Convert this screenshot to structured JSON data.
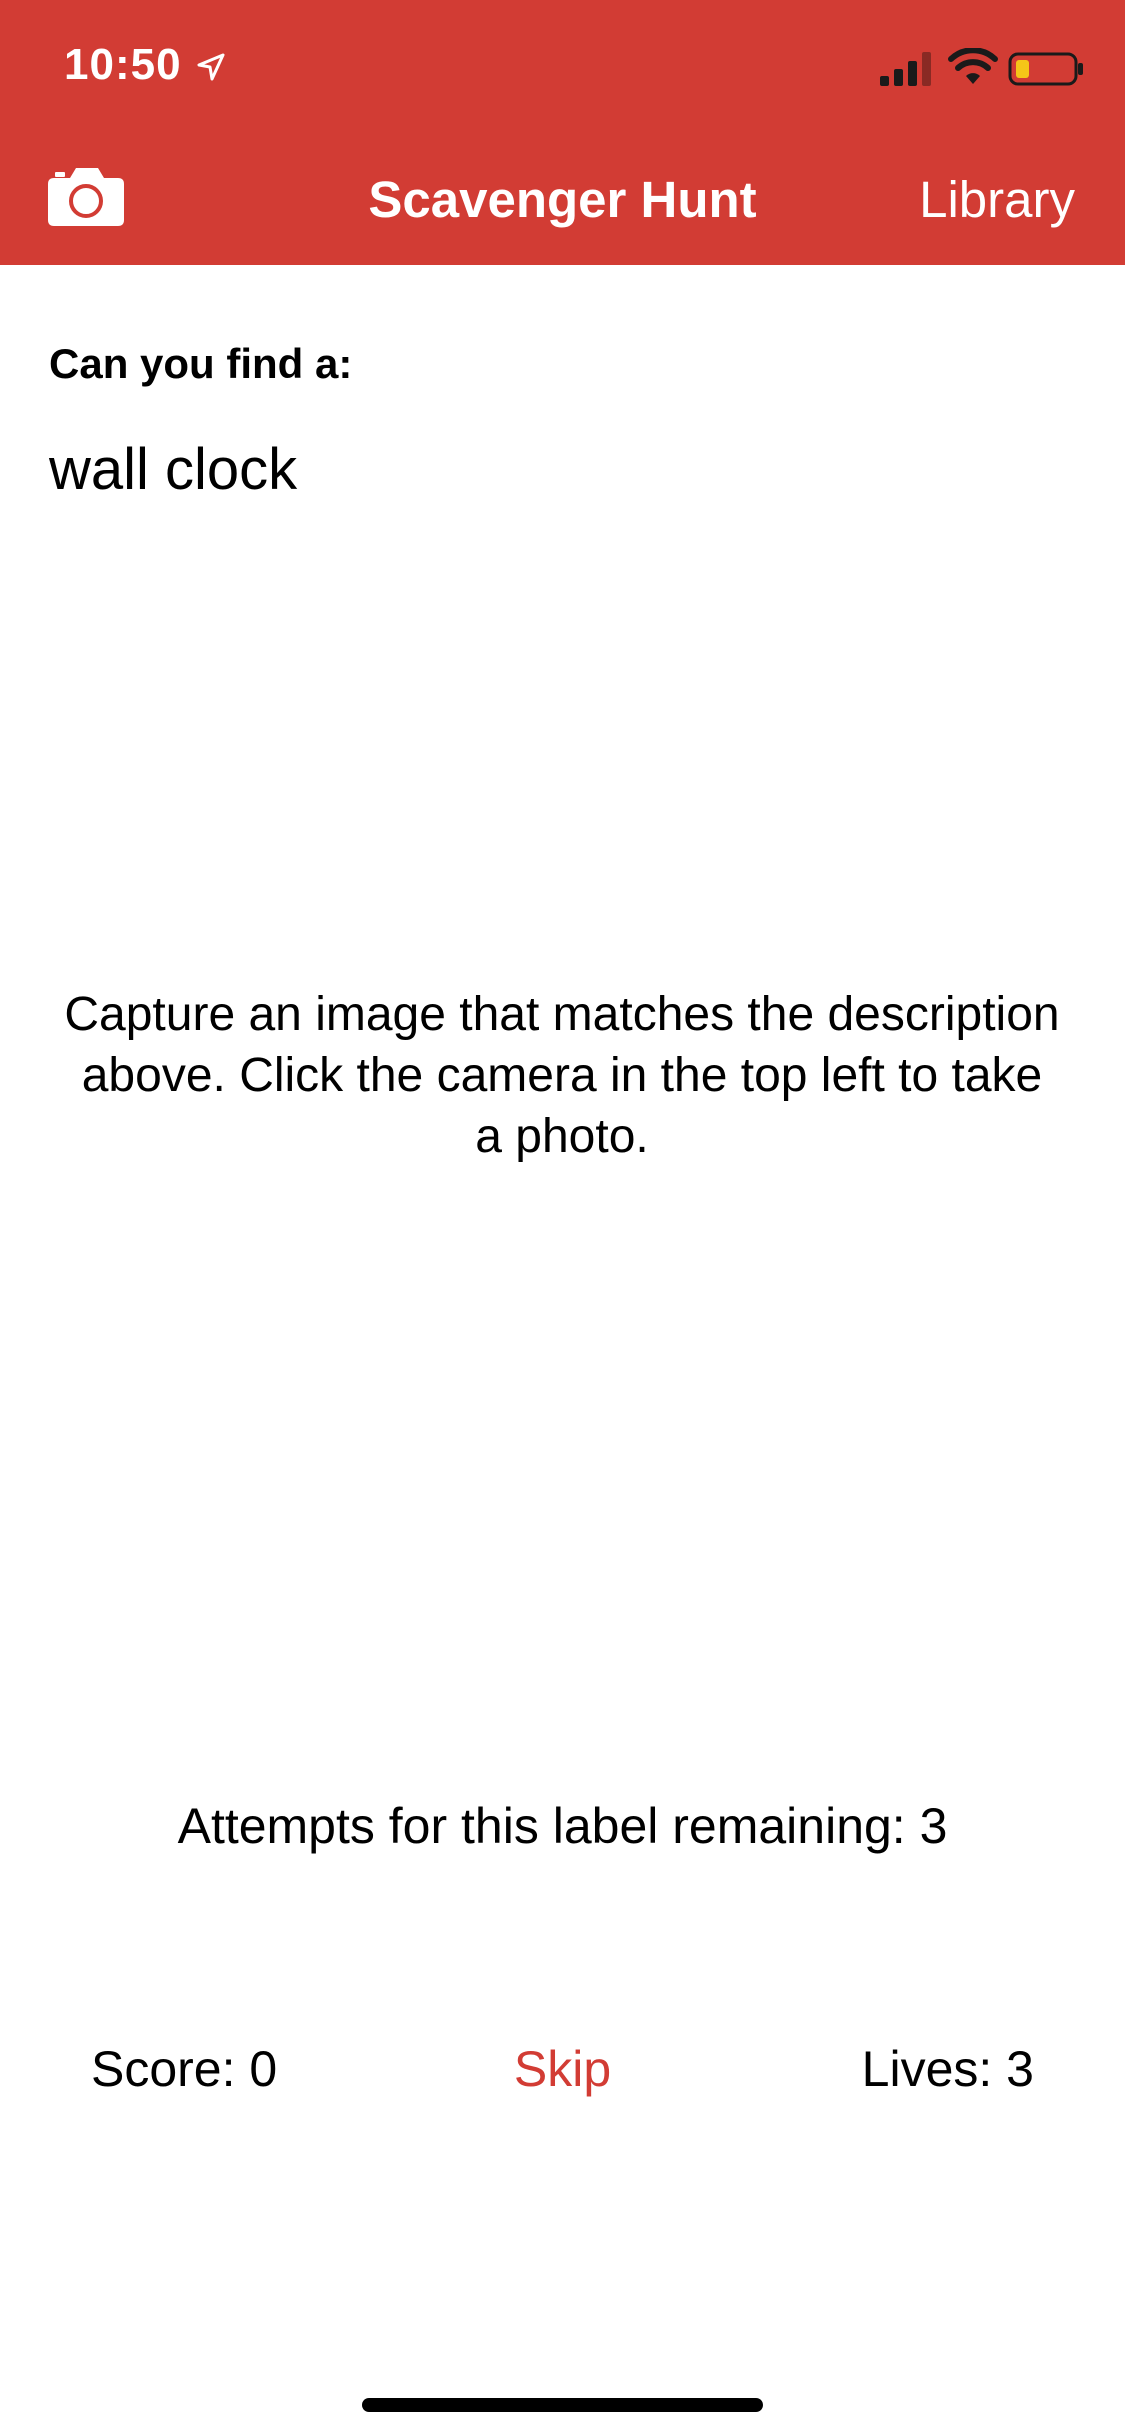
{
  "status_bar": {
    "time": "10:50",
    "icons": [
      "location-arrow-icon",
      "cellular-signal-icon",
      "wifi-icon",
      "battery-low-icon"
    ],
    "battery_color": "#f5c518"
  },
  "nav": {
    "camera_icon": "camera-icon",
    "title": "Scavenger Hunt",
    "library_label": "Library",
    "background_color": "#d23c34"
  },
  "prompt": {
    "label": "Can you find a:",
    "item": "wall clock"
  },
  "instructions": "Capture an image that matches the description above. Click the camera in the top left to take a photo.",
  "attempts_text": "Attempts for this label remaining: 3",
  "footer": {
    "score_text": "Score: 0",
    "skip_label": "Skip",
    "lives_text": "Lives: 3",
    "accent_color": "#d23c34"
  }
}
